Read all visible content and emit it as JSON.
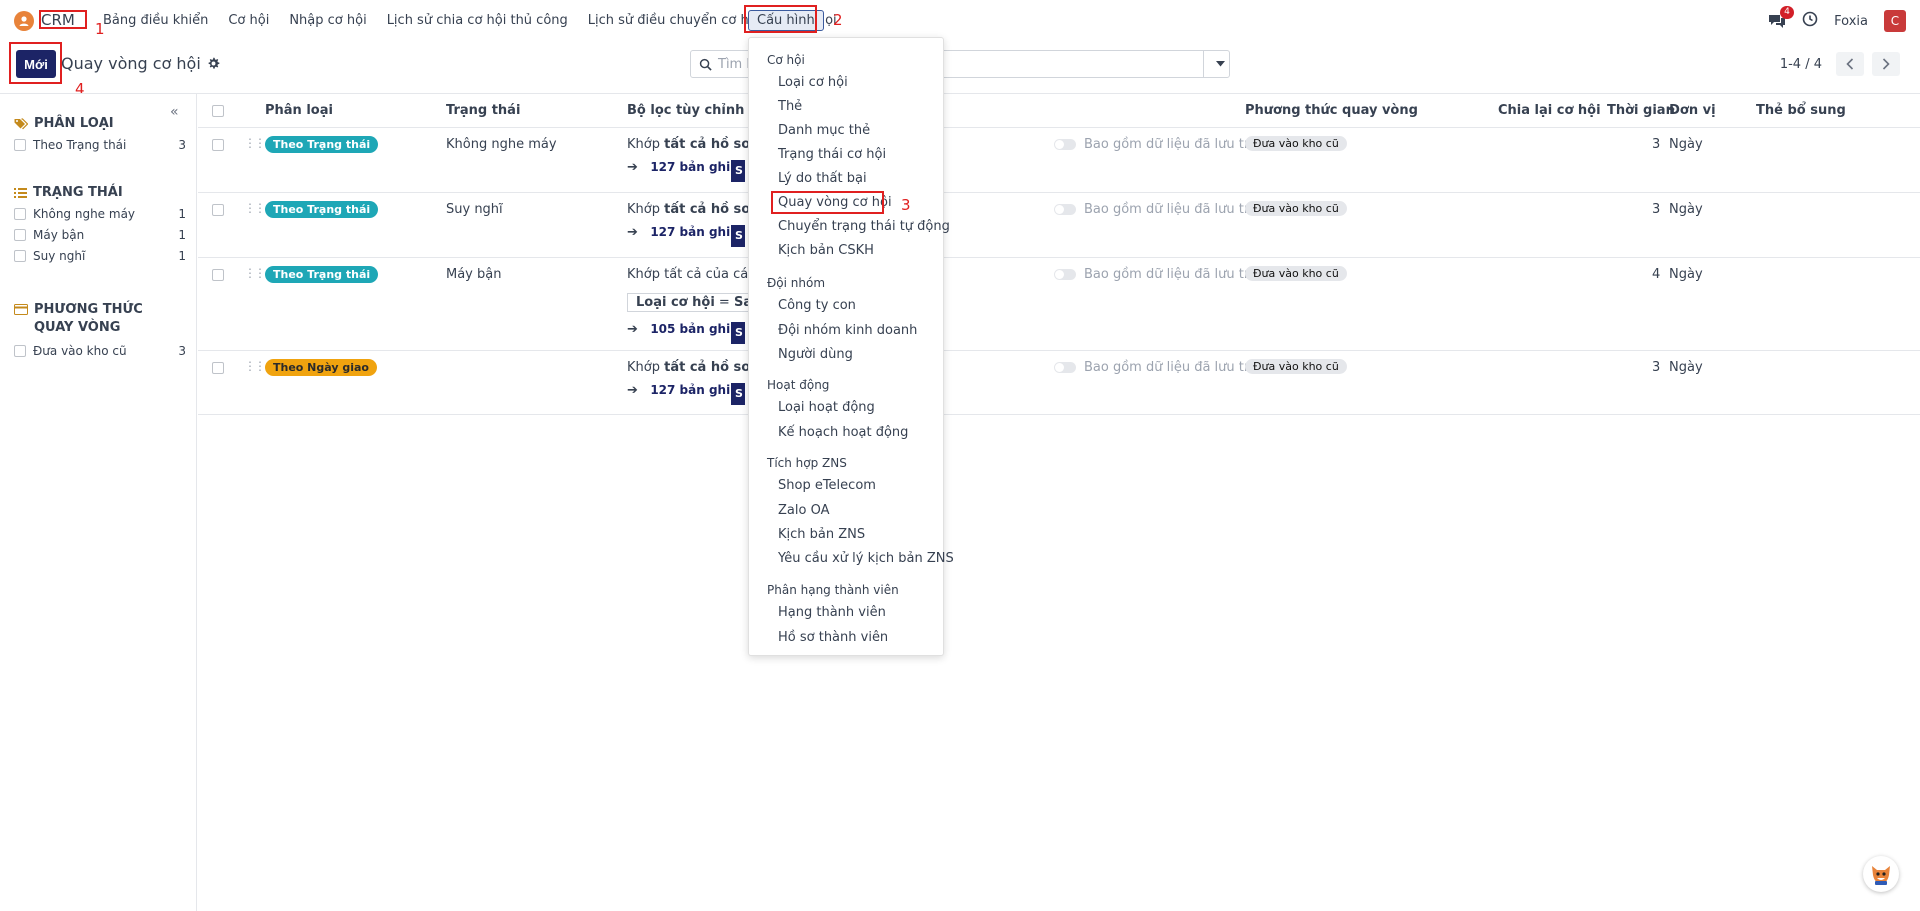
{
  "nav": {
    "brand": "CRM",
    "items": [
      "Bảng điều khiển",
      "Cơ hội",
      "Nhập cơ hội",
      "Lịch sử chia cơ hội thủ công",
      "Lịch sử điều chuyển cơ hội",
      "Cuộc gọi"
    ],
    "active": "Cấu hình",
    "chat_badge": "4",
    "user": "Foxia",
    "avatar_letter": "C"
  },
  "annotations": [
    "1",
    "2",
    "3",
    "4"
  ],
  "control": {
    "new_label": "Mới",
    "title": "Quay vòng cơ hội",
    "search_placeholder": "Tìm k",
    "pager": "1-4 / 4"
  },
  "sidebar": {
    "collapse": "«",
    "groups": [
      {
        "title": "PHÂN LOẠI",
        "icon": "tags-icon",
        "items": [
          {
            "label": "Theo Trạng thái",
            "count": "3"
          }
        ]
      },
      {
        "title": "TRẠNG THÁI",
        "icon": "list-icon",
        "items": [
          {
            "label": "Không nghe máy",
            "count": "1"
          },
          {
            "label": "Máy bận",
            "count": "1"
          },
          {
            "label": "Suy nghĩ",
            "count": "1"
          }
        ]
      },
      {
        "title": "PHƯƠNG THỨC QUAY VÒNG",
        "icon": "card-icon",
        "items": [
          {
            "label": "Đưa vào kho cũ",
            "count": "3"
          }
        ]
      }
    ]
  },
  "table": {
    "headers": [
      "Phân loại",
      "Trạng thái",
      "Bộ lọc tùy chỉnh",
      "Phương thức quay vòng",
      "Chia lại cơ hội",
      "Thời gian",
      "Đơn vị",
      "Thẻ bổ sung"
    ],
    "rows": [
      {
        "tag": "Theo Trạng thái",
        "tag_color": "#1ea7b6",
        "status": "Không nghe máy",
        "filter_prefix": "Khớp ",
        "filter_bold": "tất cả hồ sơ",
        "records": "127 bản ghi",
        "archive": "Bao gồm dữ liệu đã lưu trữ",
        "method": "Đưa vào kho cũ",
        "time": "3",
        "unit": "Ngày"
      },
      {
        "tag": "Theo Trạng thái",
        "tag_color": "#1ea7b6",
        "status": "Suy nghĩ",
        "filter_prefix": "Khớp ",
        "filter_bold": "tất cả hồ sơ",
        "records": "127 bản ghi",
        "archive": "Bao gồm dữ liệu đã lưu trữ",
        "method": "Đưa vào kho cũ",
        "time": "3",
        "unit": "Ngày"
      },
      {
        "tag": "Theo Trạng thái",
        "tag_color": "#1ea7b6",
        "status": "Máy bận",
        "filter_prefix": "Khớp tất cả của các q",
        "filter_bold": "",
        "cond_field": "Loại cơ hội",
        "cond_op": "=",
        "cond_value": "Sale",
        "records": "105 bản ghi",
        "archive": "Bao gồm dữ liệu đã lưu trữ",
        "method": "Đưa vào kho cũ",
        "time": "4",
        "unit": "Ngày"
      },
      {
        "tag": "Theo Ngày giao",
        "tag_color": "#f0a30f",
        "status": "",
        "filter_prefix": "Khớp ",
        "filter_bold": "tất cả hồ sơ",
        "records": "127 bản ghi",
        "archive": "Bao gồm dữ liệu đã lưu trữ",
        "method": "Đưa vào kho cũ",
        "time": "3",
        "unit": "Ngày"
      }
    ],
    "mini_btn": "S"
  },
  "dropdown": {
    "sections": [
      {
        "title": "Cơ hội",
        "items": [
          "Loại cơ hội",
          "Thẻ",
          "Danh mục thẻ",
          "Trạng thái cơ hội",
          "Lý do thất bại",
          "Quay vòng cơ hội",
          "Chuyển trạng thái tự động",
          "Kịch bản CSKH"
        ]
      },
      {
        "title": "Đội nhóm",
        "items": [
          "Công ty con",
          "Đội nhóm kinh doanh",
          "Người dùng"
        ]
      },
      {
        "title": "Hoạt động",
        "items": [
          "Loại hoạt động",
          "Kế hoạch hoạt động"
        ]
      },
      {
        "title": "Tích hợp ZNS",
        "items": [
          "Shop eTelecom",
          "Zalo OA",
          "Kịch bản ZNS",
          "Yêu cầu xử lý kịch bản ZNS"
        ]
      },
      {
        "title": "Phân hạng thành viên",
        "items": [
          "Hạng thành viên",
          "Hồ sơ thành viên"
        ]
      }
    ]
  }
}
